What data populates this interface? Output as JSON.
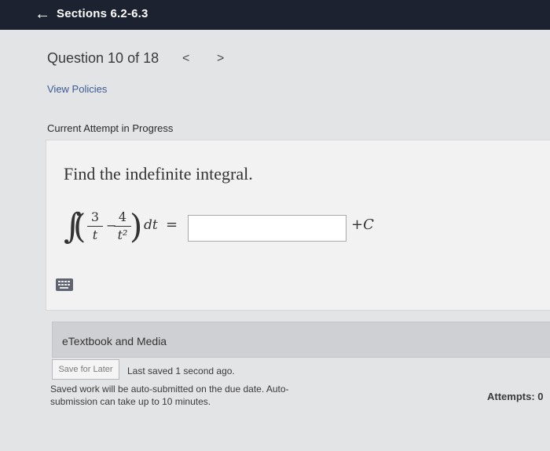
{
  "header": {
    "title": "Sections 6.2-6.3"
  },
  "question_nav": {
    "label": "Question 10 of 18",
    "prev": "<",
    "next": ">"
  },
  "links": {
    "view_policies": "View Policies"
  },
  "attempt_status": "Current Attempt in Progress",
  "question": {
    "prompt": "Find the indefinite integral.",
    "integral_sign": "∫",
    "paren_left": "(",
    "paren_right": ")",
    "term1_num": "3",
    "term1_den": "t",
    "minus": "−",
    "term2_num": "4",
    "term2_den": "t²",
    "differential": "dt",
    "equals": "=",
    "answer_value": "",
    "constant": "+C"
  },
  "etextbook": {
    "label": "eTextbook and Media"
  },
  "footer": {
    "save_for_later": "Save for Later",
    "last_saved": "Last saved 1 second ago.",
    "note": "Saved work will be auto-submitted on the due date. Auto-submission can take up to 10 minutes.",
    "attempts": "Attempts: 0"
  }
}
